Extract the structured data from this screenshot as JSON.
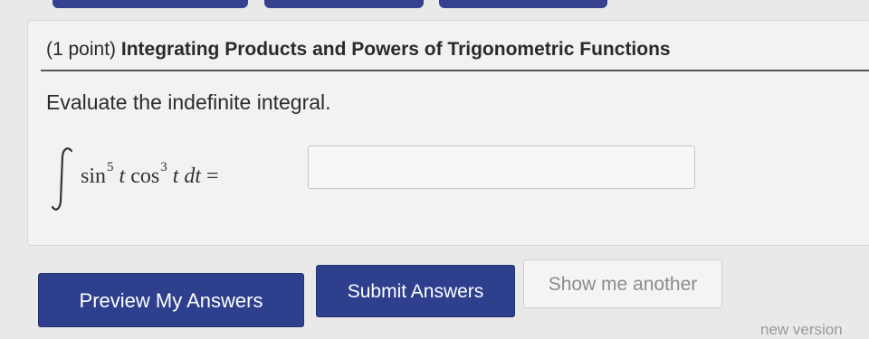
{
  "problem": {
    "points": "(1 point)",
    "title": "Integrating Products and Powers of Trigonometric Functions",
    "instruction": "Evaluate the indefinite integral."
  },
  "math": {
    "sin": "sin",
    "sin_power": "5",
    "t1": "t",
    "cos": "cos",
    "cos_power": "3",
    "t2": "t",
    "dt": "dt",
    "equals": "="
  },
  "answer": {
    "value": "",
    "placeholder": ""
  },
  "buttons": {
    "preview": "Preview My Answers",
    "submit": "Submit Answers",
    "another": "Show me another"
  },
  "footer": {
    "partial_text": "new version"
  },
  "colors": {
    "primary_button": "#2e3f8d",
    "disabled_button_text": "#8b8b8b",
    "card_background": "#f2f2f2"
  }
}
